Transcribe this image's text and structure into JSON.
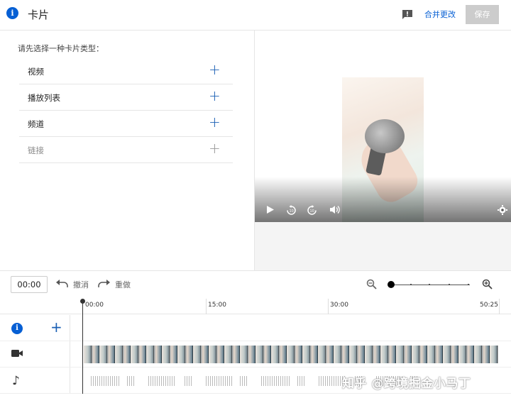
{
  "header": {
    "title": "卡片",
    "discard_label": "合并更改",
    "save_label": "保存"
  },
  "panel": {
    "prompt": "请先选择一种卡片类型：",
    "card_types": [
      {
        "label": "视频",
        "enabled": true
      },
      {
        "label": "播放列表",
        "enabled": true
      },
      {
        "label": "频道",
        "enabled": true
      },
      {
        "label": "链接",
        "enabled": false
      }
    ],
    "add_symbol": "+"
  },
  "toolbar": {
    "current_time": "00:00",
    "undo_label": "撤消",
    "redo_label": "重做"
  },
  "timeline": {
    "ticks": [
      "00:00",
      "15:00",
      "30:00",
      "50:25"
    ]
  },
  "icons": {
    "info": "info-icon",
    "feedback": "feedback-icon",
    "play": "play-icon",
    "rewind": "rewind-10-icon",
    "forward": "forward-10-icon",
    "volume": "volume-icon",
    "settings": "gear-icon",
    "camera": "video-camera-icon",
    "music": "music-note-icon"
  },
  "watermark": "知乎 @跨境掘金小马丁",
  "colors": {
    "accent": "#065fd4",
    "save_disabled": "#cccccc"
  }
}
